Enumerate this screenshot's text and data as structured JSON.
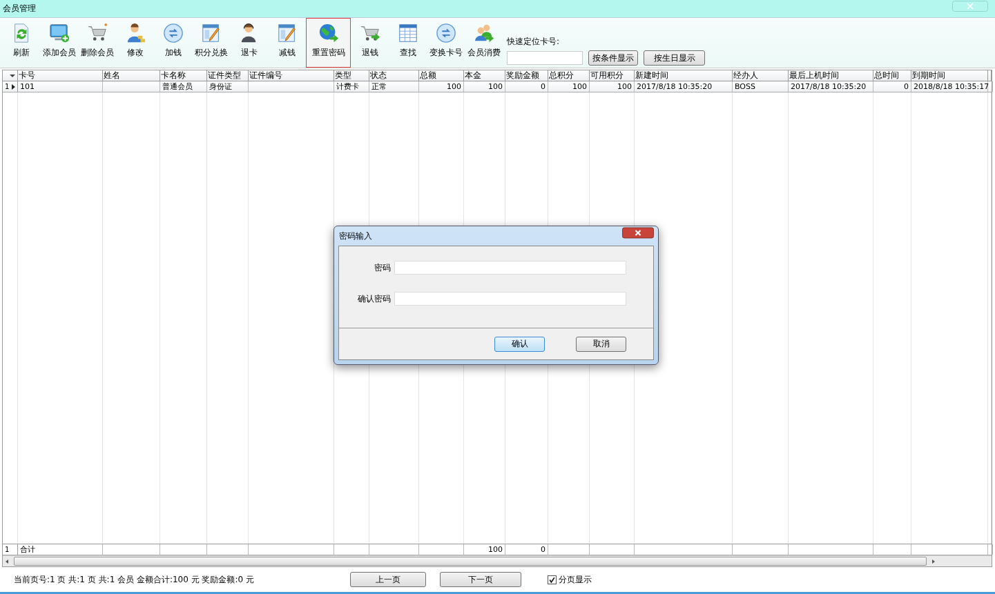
{
  "window": {
    "title": "会员管理"
  },
  "toolbar": [
    {
      "label": "刷新",
      "selected": false
    },
    {
      "label": "添加会员",
      "selected": false
    },
    {
      "label": "删除会员",
      "selected": false
    },
    {
      "label": "修改",
      "selected": false
    },
    {
      "label": "加钱",
      "selected": false
    },
    {
      "label": "积分兑换",
      "selected": false
    },
    {
      "label": "退卡",
      "selected": false
    },
    {
      "label": "减钱",
      "selected": false
    },
    {
      "label": "重置密码",
      "selected": true
    },
    {
      "label": "退钱",
      "selected": false
    },
    {
      "label": "查找",
      "selected": false
    },
    {
      "label": "变换卡号",
      "selected": false
    },
    {
      "label": "会员消费",
      "selected": false
    }
  ],
  "quick_search": {
    "label": "快速定位卡号:",
    "buttons": [
      "按条件显示",
      "按生日显示"
    ]
  },
  "table": {
    "columns": [
      "卡号",
      "姓名",
      "卡名称",
      "证件类型",
      "证件编号",
      "类型",
      "状态",
      "总额",
      "本金",
      "奖励金额",
      "总积分",
      "可用积分",
      "新建时间",
      "经办人",
      "最后上机时间",
      "总时间",
      "到期时间"
    ],
    "rows": [
      {
        "number": "1",
        "selected": true,
        "cells": [
          "101",
          "",
          "普通会员",
          "身份证",
          "",
          "计费卡",
          "正常",
          "100",
          "100",
          "0",
          "100",
          "100",
          "2017/8/18 10:35:20",
          "BOSS",
          "2017/8/18 10:35:20",
          "0",
          "2018/8/18 10:35:17"
        ]
      }
    ],
    "total_row": {
      "number": "1",
      "cells": [
        "合计",
        "",
        "",
        "",
        "",
        "",
        "",
        "",
        "100",
        "0",
        "",
        "",
        "",
        "",
        "",
        "",
        ""
      ]
    }
  },
  "status_bar": {
    "summary": "当前页号:1 页 共:1 页 共:1 会员 金额合计:100 元 奖励金额:0 元",
    "buttons": [
      "上一页",
      "下一页"
    ],
    "paging": {
      "label": "分页显示",
      "checked": true
    }
  },
  "dialog": {
    "title": "密码输入",
    "fields": [
      {
        "label": "密码"
      },
      {
        "label": "确认密码"
      }
    ],
    "buttons": [
      {
        "label": "确认",
        "selected": true
      },
      {
        "label": "取消",
        "selected": false
      }
    ]
  }
}
